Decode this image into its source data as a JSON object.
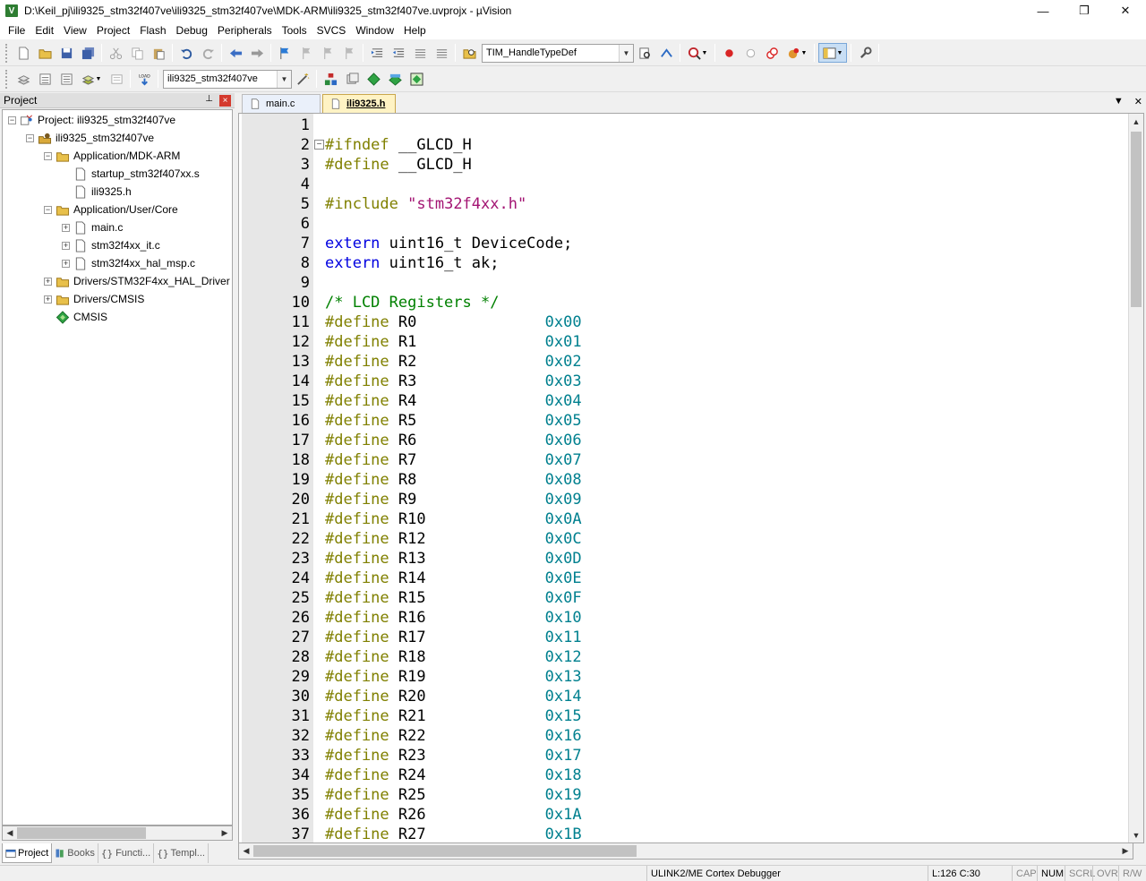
{
  "window": {
    "title": "D:\\Keil_pj\\ili9325_stm32f407ve\\ili9325_stm32f407ve\\MDK-ARM\\ili9325_stm32f407ve.uvprojx - µVision",
    "minimize": "—",
    "maximize": "❐",
    "close": "✕"
  },
  "menu": [
    "File",
    "Edit",
    "View",
    "Project",
    "Flash",
    "Debug",
    "Peripherals",
    "Tools",
    "SVCS",
    "Window",
    "Help"
  ],
  "toolbar1": {
    "find_combo_value": "TIM_HandleTypeDef"
  },
  "toolbar2": {
    "target_combo_value": "ili9325_stm32f407ve"
  },
  "project_panel": {
    "title": "Project",
    "pin": "⊥",
    "close": "×",
    "tree": [
      {
        "label": "Project: ili9325_stm32f407ve",
        "level": 0,
        "toggle": "−",
        "icon": "project-icon"
      },
      {
        "label": "ili9325_stm32f407ve",
        "level": 1,
        "toggle": "−",
        "icon": "target-icon"
      },
      {
        "label": "Application/MDK-ARM",
        "level": 2,
        "toggle": "−",
        "icon": "folder-icon"
      },
      {
        "label": "startup_stm32f407xx.s",
        "level": 3,
        "toggle": "",
        "icon": "file-icon"
      },
      {
        "label": "ili9325.h",
        "level": 3,
        "toggle": "",
        "icon": "file-icon"
      },
      {
        "label": "Application/User/Core",
        "level": 2,
        "toggle": "−",
        "icon": "folder-icon"
      },
      {
        "label": "main.c",
        "level": 3,
        "toggle": "+",
        "icon": "file-icon"
      },
      {
        "label": "stm32f4xx_it.c",
        "level": 3,
        "toggle": "+",
        "icon": "file-icon"
      },
      {
        "label": "stm32f4xx_hal_msp.c",
        "level": 3,
        "toggle": "+",
        "icon": "file-icon"
      },
      {
        "label": "Drivers/STM32F4xx_HAL_Driver",
        "level": 2,
        "toggle": "+",
        "icon": "folder-icon"
      },
      {
        "label": "Drivers/CMSIS",
        "level": 2,
        "toggle": "+",
        "icon": "folder-icon"
      },
      {
        "label": "CMSIS",
        "level": 2,
        "toggle": "",
        "icon": "cmsis-icon"
      }
    ],
    "tabs": [
      {
        "label": "Project",
        "active": true
      },
      {
        "label": "Books",
        "active": false
      },
      {
        "label": "Functi...",
        "active": false
      },
      {
        "label": "Templ...",
        "active": false
      }
    ]
  },
  "editor": {
    "tabs": [
      {
        "label": "main.c",
        "active": false
      },
      {
        "label": "ili9325.h",
        "active": true
      }
    ],
    "tab_menu": "▼",
    "tab_close": "✕",
    "fold_marker": "−",
    "lines": [
      {
        "n": "1",
        "tokens": []
      },
      {
        "n": "2",
        "tokens": [
          {
            "t": "#ifndef",
            "c": "kw-pre"
          },
          {
            "t": " __GLCD_H",
            "c": ""
          }
        ]
      },
      {
        "n": "3",
        "tokens": [
          {
            "t": "#define",
            "c": "kw-pre"
          },
          {
            "t": " __GLCD_H",
            "c": ""
          }
        ]
      },
      {
        "n": "4",
        "tokens": []
      },
      {
        "n": "5",
        "tokens": [
          {
            "t": "#include",
            "c": "kw-pre"
          },
          {
            "t": " ",
            "c": ""
          },
          {
            "t": "\"stm32f4xx.h\"",
            "c": "str"
          }
        ]
      },
      {
        "n": "6",
        "tokens": []
      },
      {
        "n": "7",
        "tokens": [
          {
            "t": "extern",
            "c": "kw"
          },
          {
            "t": " uint16_t DeviceCode;",
            "c": ""
          }
        ]
      },
      {
        "n": "8",
        "tokens": [
          {
            "t": "extern",
            "c": "kw"
          },
          {
            "t": " uint16_t ak;",
            "c": ""
          }
        ]
      },
      {
        "n": "9",
        "tokens": []
      },
      {
        "n": "10",
        "tokens": [
          {
            "t": "/* LCD Registers */",
            "c": "cmt"
          }
        ]
      },
      {
        "n": "11",
        "tokens": [
          {
            "t": "#define",
            "c": "kw-pre"
          },
          {
            "t": " R0              ",
            "c": ""
          },
          {
            "t": "0x00",
            "c": "num"
          }
        ]
      },
      {
        "n": "12",
        "tokens": [
          {
            "t": "#define",
            "c": "kw-pre"
          },
          {
            "t": " R1              ",
            "c": ""
          },
          {
            "t": "0x01",
            "c": "num"
          }
        ]
      },
      {
        "n": "13",
        "tokens": [
          {
            "t": "#define",
            "c": "kw-pre"
          },
          {
            "t": " R2              ",
            "c": ""
          },
          {
            "t": "0x02",
            "c": "num"
          }
        ]
      },
      {
        "n": "14",
        "tokens": [
          {
            "t": "#define",
            "c": "kw-pre"
          },
          {
            "t": " R3              ",
            "c": ""
          },
          {
            "t": "0x03",
            "c": "num"
          }
        ]
      },
      {
        "n": "15",
        "tokens": [
          {
            "t": "#define",
            "c": "kw-pre"
          },
          {
            "t": " R4              ",
            "c": ""
          },
          {
            "t": "0x04",
            "c": "num"
          }
        ]
      },
      {
        "n": "16",
        "tokens": [
          {
            "t": "#define",
            "c": "kw-pre"
          },
          {
            "t": " R5              ",
            "c": ""
          },
          {
            "t": "0x05",
            "c": "num"
          }
        ]
      },
      {
        "n": "17",
        "tokens": [
          {
            "t": "#define",
            "c": "kw-pre"
          },
          {
            "t": " R6              ",
            "c": ""
          },
          {
            "t": "0x06",
            "c": "num"
          }
        ]
      },
      {
        "n": "18",
        "tokens": [
          {
            "t": "#define",
            "c": "kw-pre"
          },
          {
            "t": " R7              ",
            "c": ""
          },
          {
            "t": "0x07",
            "c": "num"
          }
        ]
      },
      {
        "n": "19",
        "tokens": [
          {
            "t": "#define",
            "c": "kw-pre"
          },
          {
            "t": " R8              ",
            "c": ""
          },
          {
            "t": "0x08",
            "c": "num"
          }
        ]
      },
      {
        "n": "20",
        "tokens": [
          {
            "t": "#define",
            "c": "kw-pre"
          },
          {
            "t": " R9              ",
            "c": ""
          },
          {
            "t": "0x09",
            "c": "num"
          }
        ]
      },
      {
        "n": "21",
        "tokens": [
          {
            "t": "#define",
            "c": "kw-pre"
          },
          {
            "t": " R10             ",
            "c": ""
          },
          {
            "t": "0x0A",
            "c": "num"
          }
        ]
      },
      {
        "n": "22",
        "tokens": [
          {
            "t": "#define",
            "c": "kw-pre"
          },
          {
            "t": " R12             ",
            "c": ""
          },
          {
            "t": "0x0C",
            "c": "num"
          }
        ]
      },
      {
        "n": "23",
        "tokens": [
          {
            "t": "#define",
            "c": "kw-pre"
          },
          {
            "t": " R13             ",
            "c": ""
          },
          {
            "t": "0x0D",
            "c": "num"
          }
        ]
      },
      {
        "n": "24",
        "tokens": [
          {
            "t": "#define",
            "c": "kw-pre"
          },
          {
            "t": " R14             ",
            "c": ""
          },
          {
            "t": "0x0E",
            "c": "num"
          }
        ]
      },
      {
        "n": "25",
        "tokens": [
          {
            "t": "#define",
            "c": "kw-pre"
          },
          {
            "t": " R15             ",
            "c": ""
          },
          {
            "t": "0x0F",
            "c": "num"
          }
        ]
      },
      {
        "n": "26",
        "tokens": [
          {
            "t": "#define",
            "c": "kw-pre"
          },
          {
            "t": " R16             ",
            "c": ""
          },
          {
            "t": "0x10",
            "c": "num"
          }
        ]
      },
      {
        "n": "27",
        "tokens": [
          {
            "t": "#define",
            "c": "kw-pre"
          },
          {
            "t": " R17             ",
            "c": ""
          },
          {
            "t": "0x11",
            "c": "num"
          }
        ]
      },
      {
        "n": "28",
        "tokens": [
          {
            "t": "#define",
            "c": "kw-pre"
          },
          {
            "t": " R18             ",
            "c": ""
          },
          {
            "t": "0x12",
            "c": "num"
          }
        ]
      },
      {
        "n": "29",
        "tokens": [
          {
            "t": "#define",
            "c": "kw-pre"
          },
          {
            "t": " R19             ",
            "c": ""
          },
          {
            "t": "0x13",
            "c": "num"
          }
        ]
      },
      {
        "n": "30",
        "tokens": [
          {
            "t": "#define",
            "c": "kw-pre"
          },
          {
            "t": " R20             ",
            "c": ""
          },
          {
            "t": "0x14",
            "c": "num"
          }
        ]
      },
      {
        "n": "31",
        "tokens": [
          {
            "t": "#define",
            "c": "kw-pre"
          },
          {
            "t": " R21             ",
            "c": ""
          },
          {
            "t": "0x15",
            "c": "num"
          }
        ]
      },
      {
        "n": "32",
        "tokens": [
          {
            "t": "#define",
            "c": "kw-pre"
          },
          {
            "t": " R22             ",
            "c": ""
          },
          {
            "t": "0x16",
            "c": "num"
          }
        ]
      },
      {
        "n": "33",
        "tokens": [
          {
            "t": "#define",
            "c": "kw-pre"
          },
          {
            "t": " R23             ",
            "c": ""
          },
          {
            "t": "0x17",
            "c": "num"
          }
        ]
      },
      {
        "n": "34",
        "tokens": [
          {
            "t": "#define",
            "c": "kw-pre"
          },
          {
            "t": " R24             ",
            "c": ""
          },
          {
            "t": "0x18",
            "c": "num"
          }
        ]
      },
      {
        "n": "35",
        "tokens": [
          {
            "t": "#define",
            "c": "kw-pre"
          },
          {
            "t": " R25             ",
            "c": ""
          },
          {
            "t": "0x19",
            "c": "num"
          }
        ]
      },
      {
        "n": "36",
        "tokens": [
          {
            "t": "#define",
            "c": "kw-pre"
          },
          {
            "t": " R26             ",
            "c": ""
          },
          {
            "t": "0x1A",
            "c": "num"
          }
        ]
      },
      {
        "n": "37",
        "tokens": [
          {
            "t": "#define",
            "c": "kw-pre"
          },
          {
            "t": " R27             ",
            "c": ""
          },
          {
            "t": "0x1B",
            "c": "num"
          }
        ]
      }
    ]
  },
  "statusbar": {
    "debugger": "ULINK2/ME Cortex Debugger",
    "position": "L:126 C:30",
    "caps": "CAP",
    "num": "NUM",
    "scrl": "SCRL",
    "ovr": "OVR",
    "rw": "R/W"
  },
  "colors": {
    "preprocessor": "#808000",
    "keyword": "#0000e0",
    "string": "#a31573",
    "comment": "#008000",
    "number": "#00808f",
    "active_tab": "#fff3c4"
  }
}
